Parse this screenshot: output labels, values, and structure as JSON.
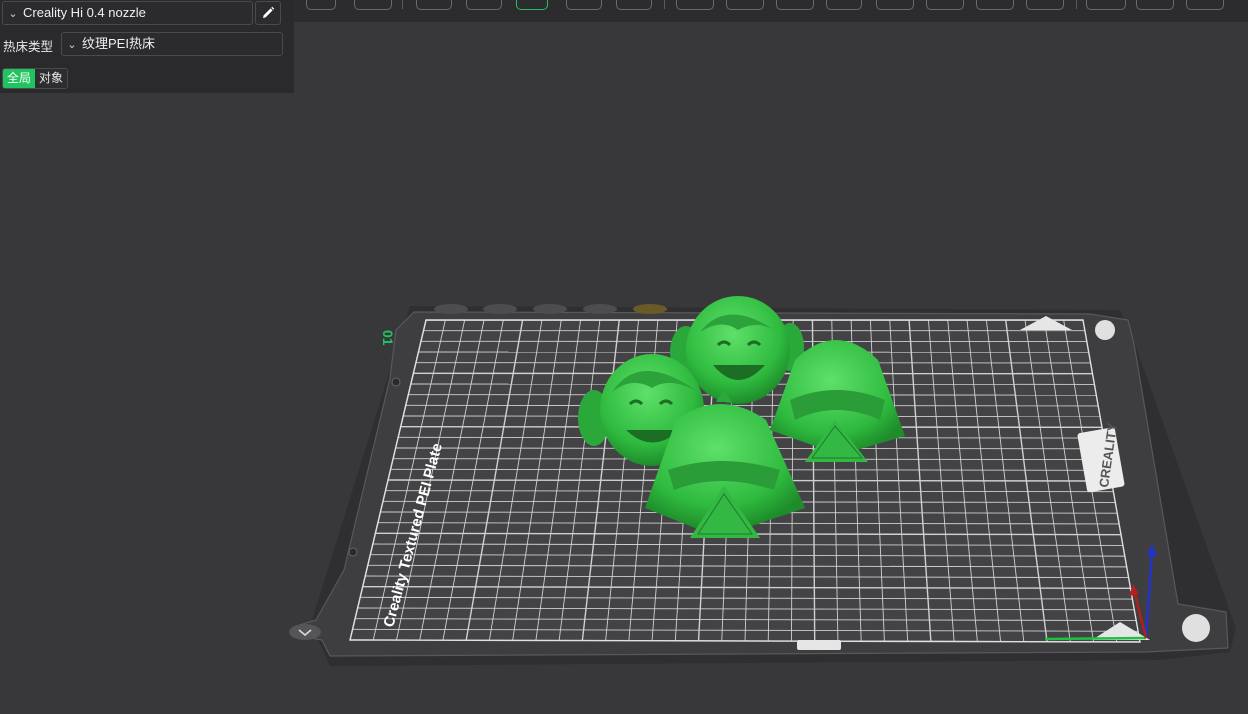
{
  "panel": {
    "printer": "Creality Hi 0.4 nozzle",
    "bed_type_label": "热床类型",
    "bed_type_value": "纹理PEI热床",
    "scope_global": "全局",
    "scope_object": "对象"
  },
  "plate": {
    "number": "01",
    "name_text": "Creality Textured PEI Plate",
    "brand_text": "CREALITY"
  },
  "colors": {
    "accent": "#1fc45f",
    "model": "#34c447",
    "plate": "#3d3d40",
    "grid": "#d9d9d9",
    "background": "#38383a"
  },
  "icons": {
    "dropdown": "chevron-down-icon",
    "edit": "pencil-icon"
  }
}
